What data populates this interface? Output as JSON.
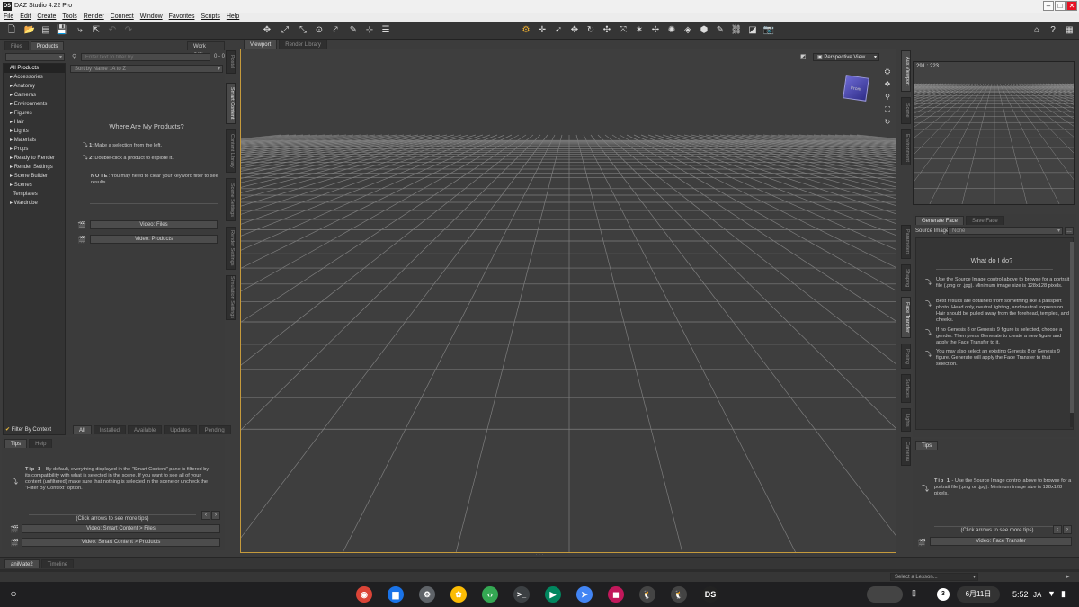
{
  "window": {
    "title": "DAZ Studio 4.22 Pro",
    "logo": "DS",
    "min": "–",
    "max": "□",
    "close": "✕"
  },
  "menu": [
    "File",
    "Edit",
    "Create",
    "Tools",
    "Render",
    "Connect",
    "Window",
    "Favorites",
    "Scripts",
    "Help"
  ],
  "left": {
    "tabs": [
      "Files",
      "Products"
    ],
    "work_offline": "Work Offline",
    "category_dropdown": "",
    "filter_placeholder": "Enter text to filter by",
    "count": "0 - 0",
    "sort": "Sort by Name : A to Z",
    "categories": [
      "All Products",
      "Accessories",
      "Anatomy",
      "Cameras",
      "Environments",
      "Figures",
      "Hair",
      "Lights",
      "Materials",
      "Props",
      "Ready to Render",
      "Render Settings",
      "Scene Builder",
      "Scenes",
      "Templates",
      "Wardrobe"
    ],
    "where_title": "Where Are My Products?",
    "step1_num": "1",
    "step1": ": Make a selection from the left.",
    "step2_num": "2",
    "step2": ": Double-click a product to explore it.",
    "note_label": "NOTE",
    "note": ": You may need to clear your keyword filter to see results.",
    "video_files": "Video: Files",
    "video_products": "Video: Products",
    "filter_by_context": "Filter By Context",
    "bottom_tabs": [
      "All",
      "Installed",
      "Available",
      "Updates",
      "Pending"
    ],
    "vtabs": [
      "Postal",
      "Smart Content",
      "Content Library",
      "Scene Settings",
      "Render Settings",
      "Simulation Settings"
    ]
  },
  "tips_left": {
    "tabs": [
      "Tips",
      "Help"
    ],
    "tip_label": "Tip 1",
    "tip": " - By default, everything displayed in the \"Smart Content\" pane is filtered by its compatibility with what is selected in the scene. If you want to see all of your content (unfiltered) make sure that nothing is selected in the scene or uncheck the \"Filter By Context\" option.",
    "click_arrows": "(Click arrows to see more tips)",
    "video_files": "Video: Smart Content > Files",
    "video_products": "Video: Smart Content > Products"
  },
  "viewport": {
    "tabs": [
      "Viewport",
      "Render Library"
    ],
    "view_label": "Perspective View",
    "cube_label": "Front"
  },
  "right": {
    "aux_coords": "291 : 223",
    "face_tabs": [
      "Generate Face",
      "Save Face"
    ],
    "source_label": "Source Image",
    "source_value": "None",
    "what_title": "What do I do?",
    "items": [
      "Use the Source Image control above to browse for a portrait file (.png or .jpg). Minimum image size is 128x128 pixels.",
      "Best results are obtained from something like a passport photo. Head only, neutral lighting, and neutral expression. Hair should be pulled away from the forehead, temples, and cheeks.",
      "If no Genesis 8 or Genesis 9 figure is selected, choose a gender. Then press Generate to create a new figure and apply the Face Transfer to it.",
      "You may also select an existing Genesis 8 or Genesis 9 figure. Generate will apply the Face Transfer to that selection."
    ],
    "tips_tab": "Tips",
    "tip_label": "Tip 1",
    "tip": " - Use the Source Image control above to browse for a portrait file (.png or .jpg). Minimum image size is 128x128 pixels.",
    "click_arrows": "(Click arrows to see more tips)",
    "video": "Video: Face Transfer",
    "vtabs_top": [
      "Aux Viewport",
      "Scene",
      "Environment"
    ],
    "vtabs_mid": [
      "Parameters",
      "Shaping",
      "Face Transfer",
      "Posing",
      "Surfaces",
      "Lights",
      "Cameras"
    ]
  },
  "timeline": {
    "tabs": [
      "aniMate2",
      "Timeline"
    ],
    "lesson": "Select a Lesson..."
  },
  "taskbar": {
    "launcher": "○",
    "badge": "3",
    "date": "6月11日",
    "time": "5:52",
    "ime": "JA",
    "apps": [
      {
        "name": "chrome-icon",
        "glyph": "◉",
        "color": "#db4437"
      },
      {
        "name": "files-icon",
        "glyph": "▆",
        "color": "#1a73e8"
      },
      {
        "name": "settings-icon",
        "glyph": "⚙",
        "color": "#5f6368"
      },
      {
        "name": "photos-icon",
        "glyph": "✿",
        "color": "#fbbc04"
      },
      {
        "name": "dev-icon",
        "glyph": "‹›",
        "color": "#34a853"
      },
      {
        "name": "terminal-icon",
        "glyph": ">_",
        "color": "#3c4043"
      },
      {
        "name": "play-store-icon",
        "glyph": "▶",
        "color": "#01875f"
      },
      {
        "name": "app-blue-icon",
        "glyph": "➤",
        "color": "#4285f4"
      },
      {
        "name": "app-magenta-icon",
        "glyph": "◼",
        "color": "#c2185b"
      },
      {
        "name": "penguin-icon",
        "glyph": "🐧",
        "color": "#444"
      },
      {
        "name": "penguin2-icon",
        "glyph": "🐧",
        "color": "#444"
      },
      {
        "name": "daz-studio-icon",
        "glyph": "DS",
        "color": "#222"
      }
    ]
  }
}
